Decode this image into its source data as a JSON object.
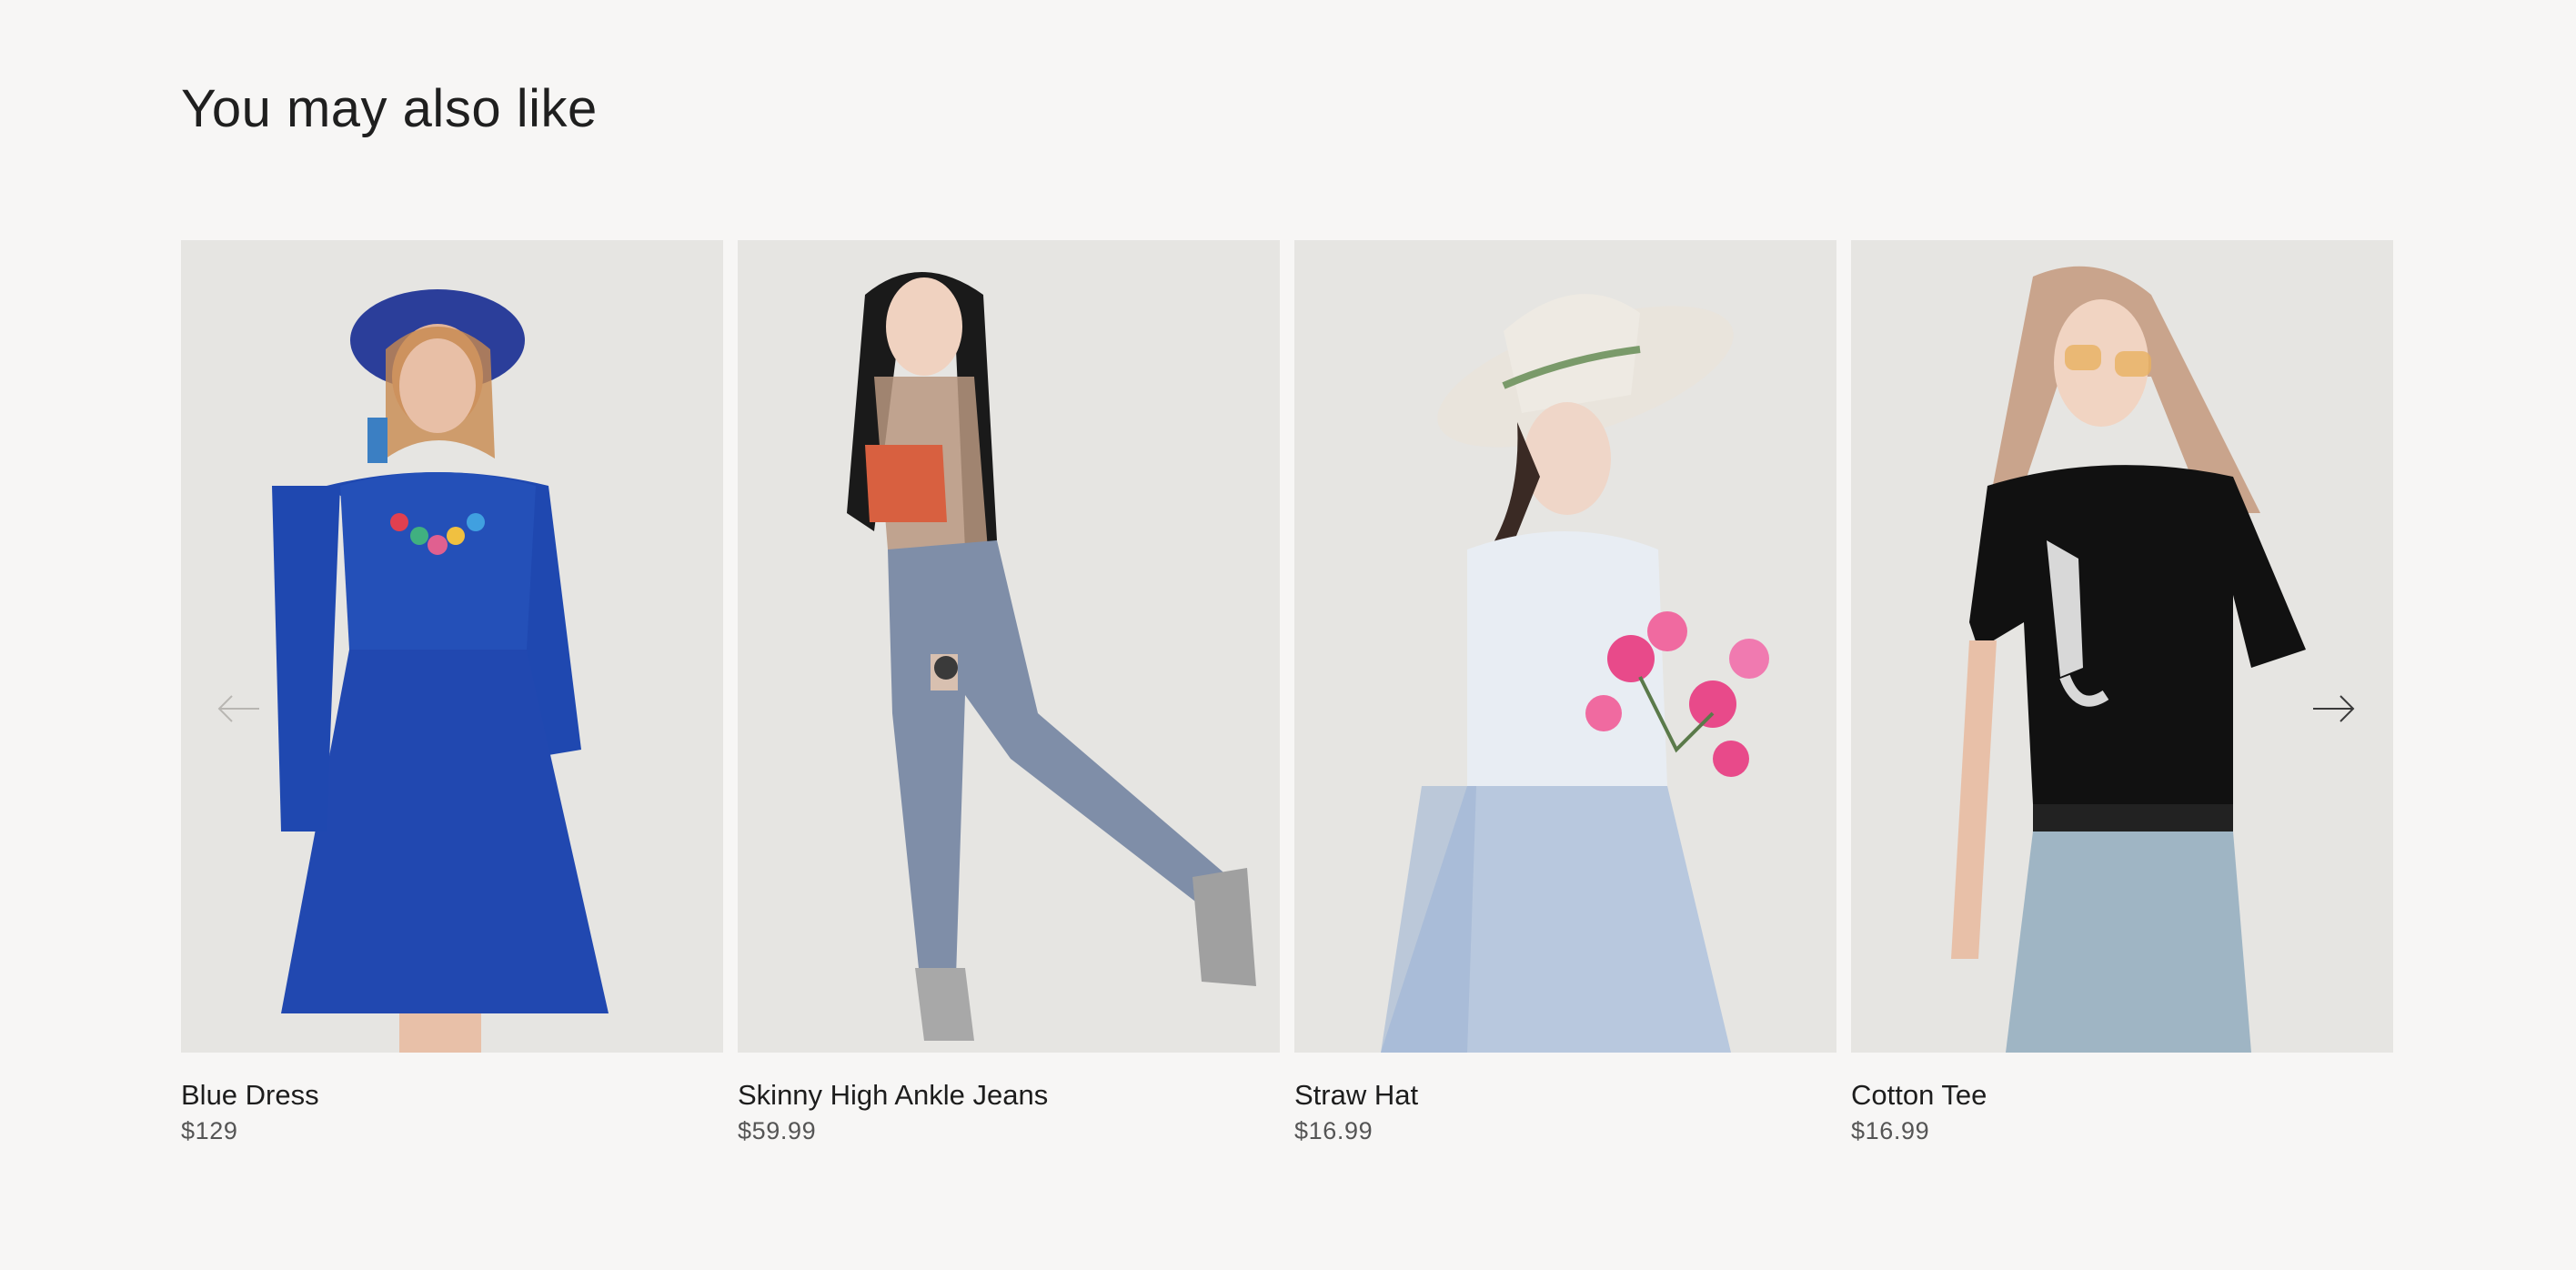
{
  "section": {
    "title": "You may also like"
  },
  "carousel": {
    "prev_icon": "arrow-left-icon",
    "next_icon": "arrow-right-icon",
    "arrow_colors": {
      "prev": "#b8b6b2",
      "next": "#3a3a3a"
    },
    "products": [
      {
        "name": "Blue Dress",
        "price": "$129",
        "image": "model-in-blue-dress-photo"
      },
      {
        "name": "Skinny High Ankle Jeans",
        "price": "$59.99",
        "image": "model-in-ripped-jeans-photo"
      },
      {
        "name": "Straw Hat",
        "price": "$16.99",
        "image": "model-in-straw-hat-photo"
      },
      {
        "name": "Cotton Tee",
        "price": "$16.99",
        "image": "model-in-black-tee-photo"
      }
    ]
  },
  "colors": {
    "background": "#f7f6f5",
    "image_background": "#e6e5e2",
    "title_text": "#1f1f1f",
    "price_text": "#555555"
  }
}
